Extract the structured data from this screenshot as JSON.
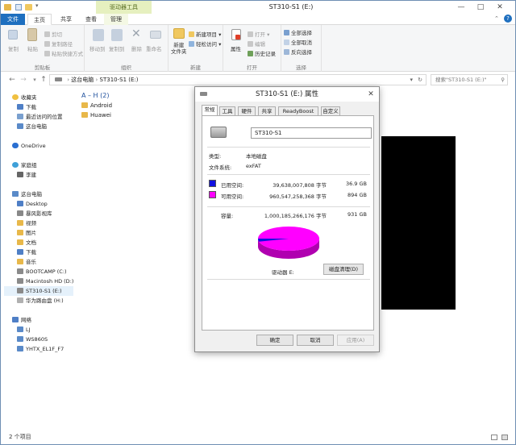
{
  "window": {
    "title": "ST310-S1 (E:)",
    "context_tab": "驱动器工具",
    "controls": [
      "—",
      "□",
      "✕"
    ]
  },
  "tabs": [
    {
      "label": "文件"
    },
    {
      "label": "主页"
    },
    {
      "label": "共享"
    },
    {
      "label": "查看"
    },
    {
      "label": "管理"
    }
  ],
  "ribbon": {
    "clipboard": {
      "label": "剪贴板",
      "copy": "复制",
      "paste": "粘贴",
      "cut": "剪切",
      "copy_path": "复制路径",
      "paste_shortcut": "粘贴快捷方式"
    },
    "organize": {
      "label": "组织",
      "move_to": "移动到",
      "copy_to": "复制到",
      "delete": "删除",
      "rename": "重命名"
    },
    "new": {
      "label": "新建",
      "new_folder": "新建\n文件夹",
      "new_item": "新建项目 ▾",
      "easy_access": "轻松访问 ▾"
    },
    "open": {
      "label": "打开",
      "properties": "属性",
      "open": "打开 ▾",
      "edit": "编辑",
      "history": "历史记录"
    },
    "select": {
      "label": "选择",
      "select_all": "全部选择",
      "select_none": "全部取消",
      "invert": "反向选择"
    }
  },
  "address": {
    "path": [
      "这台电脑",
      "ST310-S1 (E:)"
    ],
    "search_placeholder": "搜索\"ST310-S1 (E:)\""
  },
  "sidebar": {
    "items": [
      {
        "label": "收藏夹"
      },
      {
        "label": "下载"
      },
      {
        "label": "最近访问的位置"
      },
      {
        "label": "这台电脑"
      },
      {
        "label": "OneDrive"
      },
      {
        "label": "家庭组"
      },
      {
        "label": "李建"
      },
      {
        "label": "这台电脑"
      },
      {
        "label": "Desktop"
      },
      {
        "label": "暴风影视库"
      },
      {
        "label": "视频"
      },
      {
        "label": "图片"
      },
      {
        "label": "文档"
      },
      {
        "label": "下载"
      },
      {
        "label": "音乐"
      },
      {
        "label": "BOOTCAMP (C:)"
      },
      {
        "label": "Macintosh HD (D:)"
      },
      {
        "label": "ST310-S1 (E:)"
      },
      {
        "label": "华为路由盘 (H:)"
      },
      {
        "label": "网络"
      },
      {
        "label": "LJ"
      },
      {
        "label": "WS860S"
      },
      {
        "label": "YHTX_EL1F_F7"
      }
    ]
  },
  "content": {
    "group": "A – H (2)",
    "folders": [
      {
        "name": "Android"
      },
      {
        "name": "Huawei"
      }
    ]
  },
  "status": {
    "text": "2 个项目"
  },
  "dialog": {
    "title": "ST310-S1 (E:) 属性",
    "tabs": [
      {
        "label": "常规"
      },
      {
        "label": "工具"
      },
      {
        "label": "硬件"
      },
      {
        "label": "共享"
      },
      {
        "label": "ReadyBoost"
      },
      {
        "label": "自定义"
      }
    ],
    "name_value": "ST310-S1",
    "type_label": "类型:",
    "type_value": "本地磁盘",
    "fs_label": "文件系统:",
    "fs_value": "exFAT",
    "used": {
      "label": "已用空间:",
      "bytes": "39,638,007,808 字节",
      "size": "36.9 GB",
      "color": "#1010e0"
    },
    "free": {
      "label": "可用空间:",
      "bytes": "960,547,258,368 字节",
      "size": "894 GB",
      "color": "#ff00ff"
    },
    "capacity": {
      "label": "容量:",
      "bytes": "1,000,185,266,176 字节",
      "size": "931 GB"
    },
    "used_fraction": 0.0396,
    "drive_label": "驱动器 E:",
    "cleanup_btn": "磁盘清理(D)",
    "ok": "确定",
    "cancel": "取消",
    "apply": "应用(A)"
  }
}
